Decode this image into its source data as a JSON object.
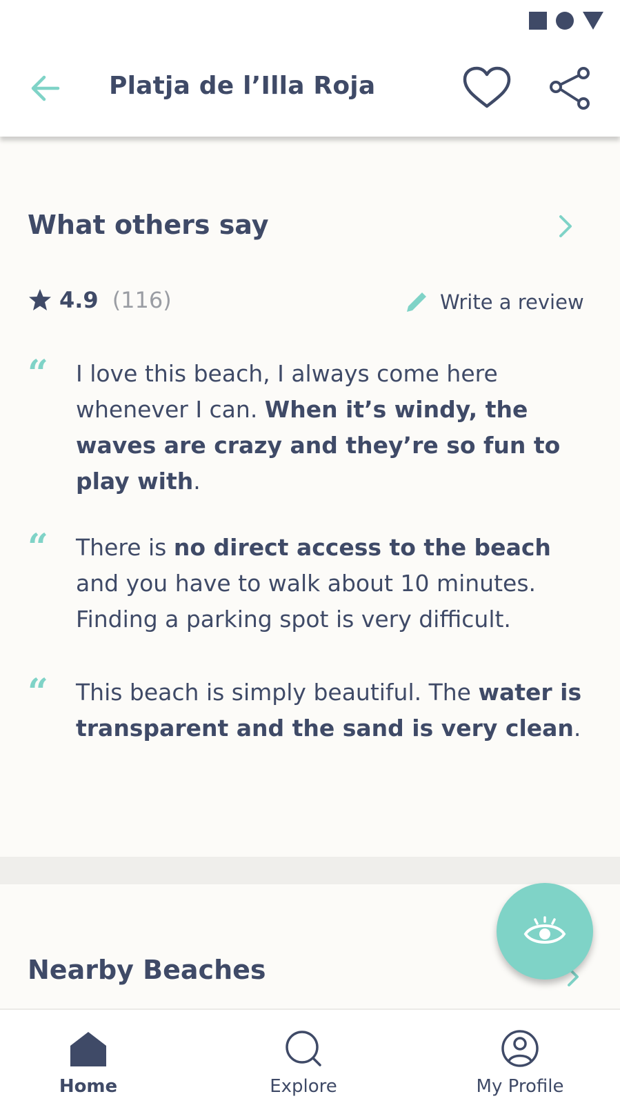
{
  "header": {
    "title": "Platja de l’Illa Roja"
  },
  "reviews": {
    "section_title": "What others say",
    "rating": "4.9",
    "count": "(116)",
    "write_label": "Write a review",
    "items": [
      {
        "parts": [
          {
            "t": "I love this beach, I always come here whenever I can. ",
            "b": false
          },
          {
            "t": "When it’s windy, the waves are crazy and they’re so fun to play with",
            "b": true
          },
          {
            "t": ".",
            "b": false
          }
        ]
      },
      {
        "parts": [
          {
            "t": "There is ",
            "b": false
          },
          {
            "t": "no direct access to the beach",
            "b": true
          },
          {
            "t": " and you have to walk about 10 minutes. Finding a parking spot is very difficult.",
            "b": false
          }
        ]
      },
      {
        "parts": [
          {
            "t": "This beach is simply beautiful. The ",
            "b": false
          },
          {
            "t": "water is transparent and the sand is very clean",
            "b": true
          },
          {
            "t": ".",
            "b": false
          }
        ]
      }
    ],
    "quote_glyph": "“"
  },
  "nearby": {
    "title": "Nearby Beaches"
  },
  "nav": {
    "home": "Home",
    "explore": "Explore",
    "profile": "My Profile",
    "active": "home"
  },
  "colors": {
    "accent": "#7fd3c7",
    "text": "#3f4a67",
    "muted": "#9a9da3",
    "background": "#fcfbf8"
  },
  "icons": {
    "status": [
      "square-icon",
      "circle-icon",
      "triangle-icon"
    ],
    "back": "arrow-left-icon",
    "favorite": "heart-icon",
    "share": "share-icon",
    "star": "star-icon",
    "edit": "pencil-icon",
    "fab": "eye-icon",
    "home": "home-icon",
    "explore": "search-icon",
    "profile": "user-icon"
  }
}
